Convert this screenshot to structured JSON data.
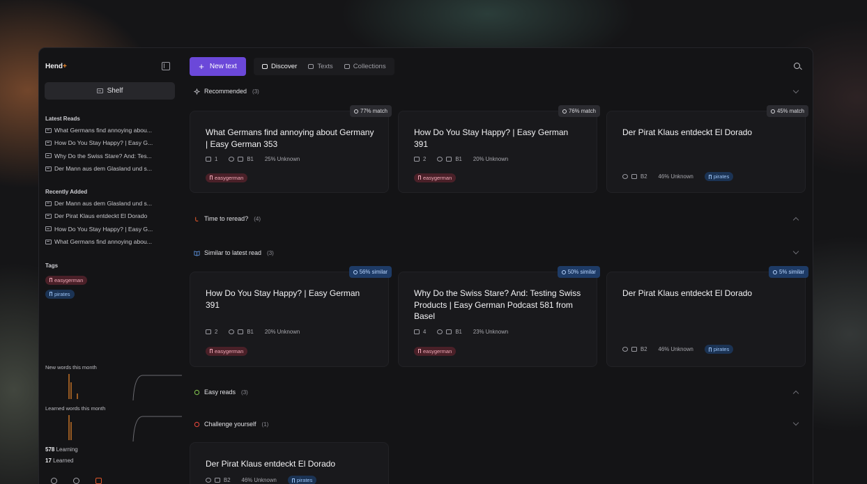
{
  "app": {
    "brand": "Hend",
    "brand_suffix": "+"
  },
  "sidebar": {
    "shelf_label": "Shelf",
    "latest_reads_label": "Latest Reads",
    "latest_reads": [
      "What Germans find annoying abou...",
      "How Do You Stay Happy? | Easy G...",
      "Why Do the Swiss Stare? And: Tes...",
      "Der Mann aus dem Glasland und s..."
    ],
    "recently_added_label": "Recently Added",
    "recently_added": [
      "Der Mann aus dem Glasland und s...",
      "Der Pirat Klaus entdeckt El Dorado",
      "How Do You Stay Happy? | Easy G...",
      "What Germans find annoying abou..."
    ],
    "tags_label": "Tags",
    "tags": [
      "easygerman",
      "pirates"
    ],
    "new_words_label": "New words this month",
    "learned_words_label": "Learned words this month",
    "learning_count": "578",
    "learning_label": "Learning",
    "learned_count": "17",
    "learned_label": "Learned"
  },
  "toolbar": {
    "new_text_label": "New text",
    "tabs": [
      "Discover",
      "Texts",
      "Collections"
    ],
    "active_tab": "Discover"
  },
  "sections": {
    "recommended": {
      "label": "Recommended",
      "count": "(3)"
    },
    "reread": {
      "label": "Time to reread?",
      "count": "(4)"
    },
    "similar": {
      "label": "Similar to latest read",
      "count": "(3)"
    },
    "easy": {
      "label": "Easy reads",
      "count": "(3)"
    },
    "challenge": {
      "label": "Challenge yourself",
      "count": "(1)"
    }
  },
  "recommended_cards": [
    {
      "badge": "77% match",
      "title": "What Germans find annoying about Germany | Easy German 353",
      "episodes": "1",
      "level": "B1",
      "unknown": "25% Unknown",
      "tag": "easygerman"
    },
    {
      "badge": "76% match",
      "title": "How Do You Stay Happy? | Easy German 391",
      "episodes": "2",
      "level": "B1",
      "unknown": "20% Unknown",
      "tag": "easygerman"
    },
    {
      "badge": "45% match",
      "title": "Der Pirat Klaus entdeckt El Dorado",
      "level": "B2",
      "unknown": "46% Unknown",
      "tag": "pirates"
    }
  ],
  "similar_cards": [
    {
      "badge": "56% similar",
      "title": "How Do You Stay Happy? | Easy German 391",
      "episodes": "2",
      "level": "B1",
      "unknown": "20% Unknown",
      "tag": "easygerman"
    },
    {
      "badge": "50% similar",
      "title": "Why Do the Swiss Stare? And: Testing Swiss Products | Easy German Podcast 581 from Basel",
      "episodes": "4",
      "level": "B1",
      "unknown": "23% Unknown",
      "tag": "easygerman"
    },
    {
      "badge": "5% similar",
      "title": "Der Pirat Klaus entdeckt El Dorado",
      "level": "B2",
      "unknown": "46% Unknown",
      "tag": "pirates"
    }
  ],
  "challenge_cards": [
    {
      "title": "Der Pirat Klaus entdeckt El Dorado",
      "level": "B2",
      "unknown": "46% Unknown",
      "tag": "pirates"
    }
  ],
  "colors": {
    "accent": "#6b48d9",
    "brand_plus": "#f08a2c",
    "tag_red_bg": "#4a2028",
    "tag_blue_bg": "#1b3354"
  }
}
